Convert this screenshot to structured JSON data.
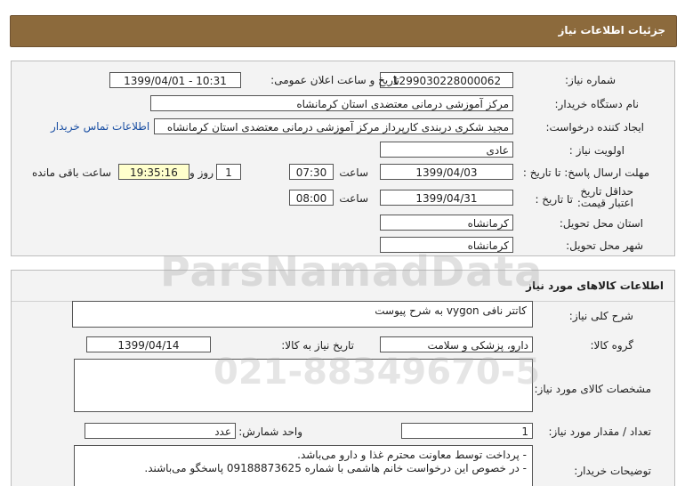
{
  "header": {
    "title": "جزئیات اطلاعات نیاز"
  },
  "need_info": {
    "need_number_label": "شماره نیاز:",
    "need_number": "1299030228000062",
    "announce_label": "تاریخ و ساعت اعلان عمومی:",
    "announce_value": "1399/04/01 - 10:31",
    "buyer_org_label": "نام دستگاه خریدار:",
    "buyer_org": "مرکز آموزشی درمانی معتضدی استان کرمانشاه",
    "creator_label": "ایجاد کننده درخواست:",
    "creator": "مجید شکری دربندی کارپرداز مرکز آموزشی درمانی معتضدی استان کرمانشاه",
    "contact_link": "اطلاعات تماس خریدار",
    "priority_label": "اولویت نیاز :",
    "priority": "عادی",
    "deadline_label": "مهلت ارسال پاسخ: تا تاریخ :",
    "deadline_date": "1399/04/03",
    "time_label": "ساعت",
    "deadline_time": "07:30",
    "days_value": "1",
    "days_label": "روز و",
    "remaining_time": "19:35:16",
    "remaining_label": "ساعت باقی مانده",
    "price_validity_label": "حداقل تاریخ اعتبار قیمت:",
    "to_date_label": "تا تاریخ :",
    "validity_date": "1399/04/31",
    "validity_time": "08:00",
    "province_label": "استان محل تحویل:",
    "province": "کرمانشاه",
    "city_label": "شهر محل تحویل:",
    "city": "کرمانشاه"
  },
  "goods_info": {
    "section_title": "اطلاعات کالاهای مورد نیاز",
    "general_desc_label": "شرح کلی نیاز:",
    "general_desc": "کاتتر نافی vygon به شرح پیوست",
    "group_label": "گروه کالا:",
    "group": "دارو، پزشکی و سلامت",
    "need_date_label": "تاریخ نیاز به کالا:",
    "need_date": "1399/04/14",
    "specs_label": "مشخصات کالای مورد نیاز:",
    "specs": "",
    "quantity_label": "تعداد / مقدار مورد نیاز:",
    "quantity": "1",
    "unit_label": "واحد شمارش:",
    "unit": "عدد",
    "buyer_notes_label": "توضیحات خریدار:",
    "buyer_notes_line1": "- پرداخت توسط معاونت محترم غذا و دارو می‌باشد.",
    "buyer_notes_line2": "- در خصوص این درخواست خانم هاشمی با شماره 09188873625 پاسخگو می‌باشند."
  },
  "watermark": {
    "brand": "ParsNamadData",
    "phone": "021-88349670-5"
  }
}
